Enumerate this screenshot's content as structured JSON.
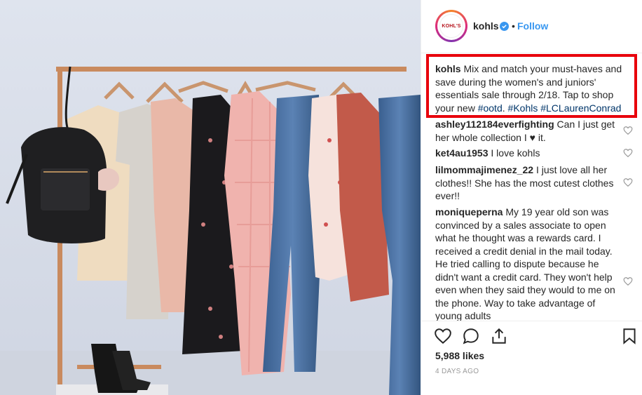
{
  "post": {
    "username": "kohls",
    "logo_text": "KOHL'S",
    "verified_icon": "verified-badge-icon",
    "separator": "•",
    "follow_label": "Follow",
    "caption": {
      "username": "kohls",
      "text": " Mix and match your must-haves and save during the women's and juniors' essentials sale through 2/18. Tap to shop your new ",
      "hashtags": [
        "#ootd",
        "#Kohls",
        "#LCLaurenConrad"
      ]
    },
    "comments": [
      {
        "username": "ashley112184everfighting",
        "text": " Can I just get her whole collection I ♥ it."
      },
      {
        "username": "ket4au1953",
        "text": " I love kohls"
      },
      {
        "username": "lilmommajimenez_22",
        "text": " I just love all her clothes!! She has the most cutest clothes ever!!"
      },
      {
        "username": "moniqueperna",
        "text": " My 19 year old son was convinced by a sales associate to open what he thought was a rewards card. I received a credit denial in the mail today. He tried calling to dispute because he didn't want a credit card. They won't help even when they said they would to me on the phone. Way to take advantage of young adults"
      }
    ],
    "likes": "5,988 likes",
    "time_ago": "4 DAYS AGO"
  },
  "colors": {
    "accent_blue": "#3897f0",
    "highlight_red": "#e8000b",
    "hashtag": "#003569",
    "brand_red": "#b5121b"
  }
}
